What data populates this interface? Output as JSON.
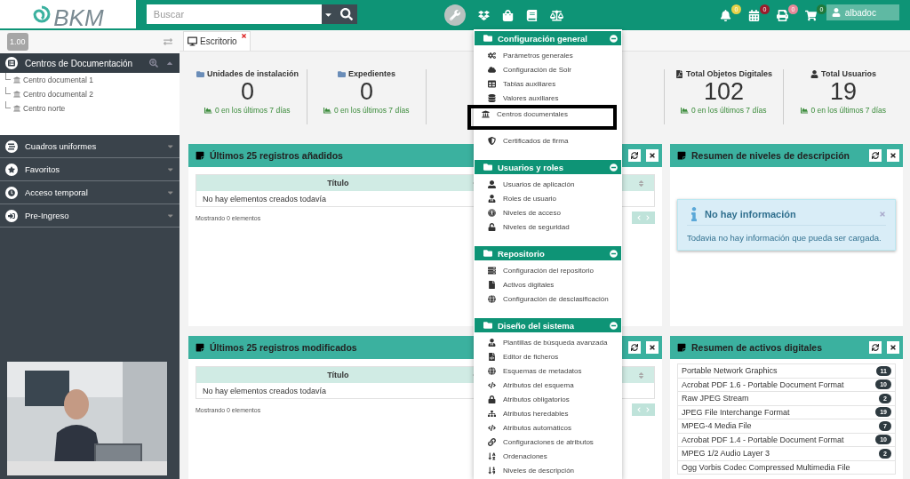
{
  "header": {
    "logo": "BKM",
    "search": {
      "placeholder": "Buscar"
    },
    "notifications": [
      {
        "count": "0",
        "color": "#e6d24a"
      },
      {
        "count": "0",
        "color": "#9b1c2c"
      },
      {
        "count": "0",
        "color": "#e8899a"
      },
      {
        "count": "0",
        "color": "#1f7a3c"
      }
    ],
    "user": "albadoc"
  },
  "sidebar": {
    "version": "1.00",
    "tree": {
      "title": "Centros de Documentación",
      "expanded": true,
      "children": [
        {
          "label": "Centro documental 1"
        },
        {
          "label": "Centro documental 2"
        },
        {
          "label": "Centro norte"
        }
      ]
    },
    "sections": [
      {
        "label": "Cuadros uniformes"
      },
      {
        "label": "Favoritos"
      },
      {
        "label": "Acceso temporal"
      },
      {
        "label": "Pre-Ingreso"
      }
    ]
  },
  "tabs": [
    {
      "label": "Escritorio",
      "selected": true
    }
  ],
  "stats": [
    {
      "title": "Unidades de instalación",
      "value": "0",
      "trend": "0 en los últimos 7 días"
    },
    {
      "title": "Expedientes",
      "value": "0",
      "trend": "0 en los últimos 7 días"
    },
    {
      "title": "Total Objetos Digitales",
      "value": "102",
      "trend": "0 en los últimos 7 días"
    },
    {
      "title": "Total Usuarios",
      "value": "19",
      "trend": "0 en los últimos 7 días"
    }
  ],
  "panels": {
    "added": {
      "title": "Últimos 25 registros añadidos",
      "column": "Título",
      "empty": "No hay elementos creados todavía",
      "footer": "Mostrando 0 elementos"
    },
    "modified": {
      "title": "Últimos 25 registros modificados",
      "column": "Título",
      "empty": "No hay elementos creados todavía",
      "footer": "Mostrando 0 elementos"
    },
    "levels": {
      "title": "Resumen de niveles de descripción",
      "alert_title": "No hay información",
      "alert_text": "Todavia no hay información que pueda ser cargada."
    },
    "assets": {
      "title": "Resumen de activos digitales",
      "items": [
        {
          "name": "Portable Network Graphics",
          "count": "11"
        },
        {
          "name": "Acrobat PDF 1.6 - Portable Document Format",
          "count": "10"
        },
        {
          "name": "Raw JPEG Stream",
          "count": "2"
        },
        {
          "name": "JPEG File Interchange Format",
          "count": "19"
        },
        {
          "name": "MPEG-4 Media File",
          "count": "7"
        },
        {
          "name": "Acrobat PDF 1.4 - Portable Document Format",
          "count": "10"
        },
        {
          "name": "MPEG 1/2 Audio Layer 3",
          "count": "2"
        },
        {
          "name": "Ogg Vorbis Codec Compressed Multimedia File"
        }
      ]
    }
  },
  "menu": {
    "sections": [
      {
        "title": "Configuración general",
        "items": [
          {
            "label": "Parámetros generales",
            "highlighted": false
          },
          {
            "label": "Configuración de Solr",
            "highlighted": false
          },
          {
            "label": "Tablas auxiliares",
            "highlighted": false
          },
          {
            "label": "Valores auxiliares",
            "highlighted": false
          },
          {
            "label": "Centros documentales",
            "highlighted": true
          },
          {
            "label": "Certificados de firma",
            "highlighted": false
          }
        ]
      },
      {
        "title": "Usuarios y roles",
        "items": [
          {
            "label": "Usuarios de aplicación",
            "highlighted": false
          },
          {
            "label": "Roles de usuario",
            "highlighted": false
          },
          {
            "label": "Niveles de acceso",
            "highlighted": false
          },
          {
            "label": "Niveles de seguridad",
            "highlighted": false
          }
        ]
      },
      {
        "title": "Repositorio",
        "items": [
          {
            "label": "Configuración del repositorio",
            "highlighted": false
          },
          {
            "label": "Activos digitales",
            "highlighted": false
          },
          {
            "label": "Configuración de desclasificación",
            "highlighted": false
          }
        ]
      },
      {
        "title": "Diseño del sistema",
        "items": [
          {
            "label": "Plantillas de búsqueda avanzada",
            "highlighted": false
          },
          {
            "label": "Editor de ficheros",
            "highlighted": false
          },
          {
            "label": "Esquemas de metadatos",
            "highlighted": false
          },
          {
            "label": "Atributos del esquema",
            "highlighted": false
          },
          {
            "label": "Atributos obligatorios",
            "highlighted": false
          },
          {
            "label": "Atributos heredables",
            "highlighted": false
          },
          {
            "label": "Atributos automáticos",
            "highlighted": false
          },
          {
            "label": "Configuraciones de atributos",
            "highlighted": false
          },
          {
            "label": "Ordenaciones",
            "highlighted": false
          },
          {
            "label": "Niveles de descripción",
            "highlighted": false
          }
        ]
      }
    ]
  }
}
